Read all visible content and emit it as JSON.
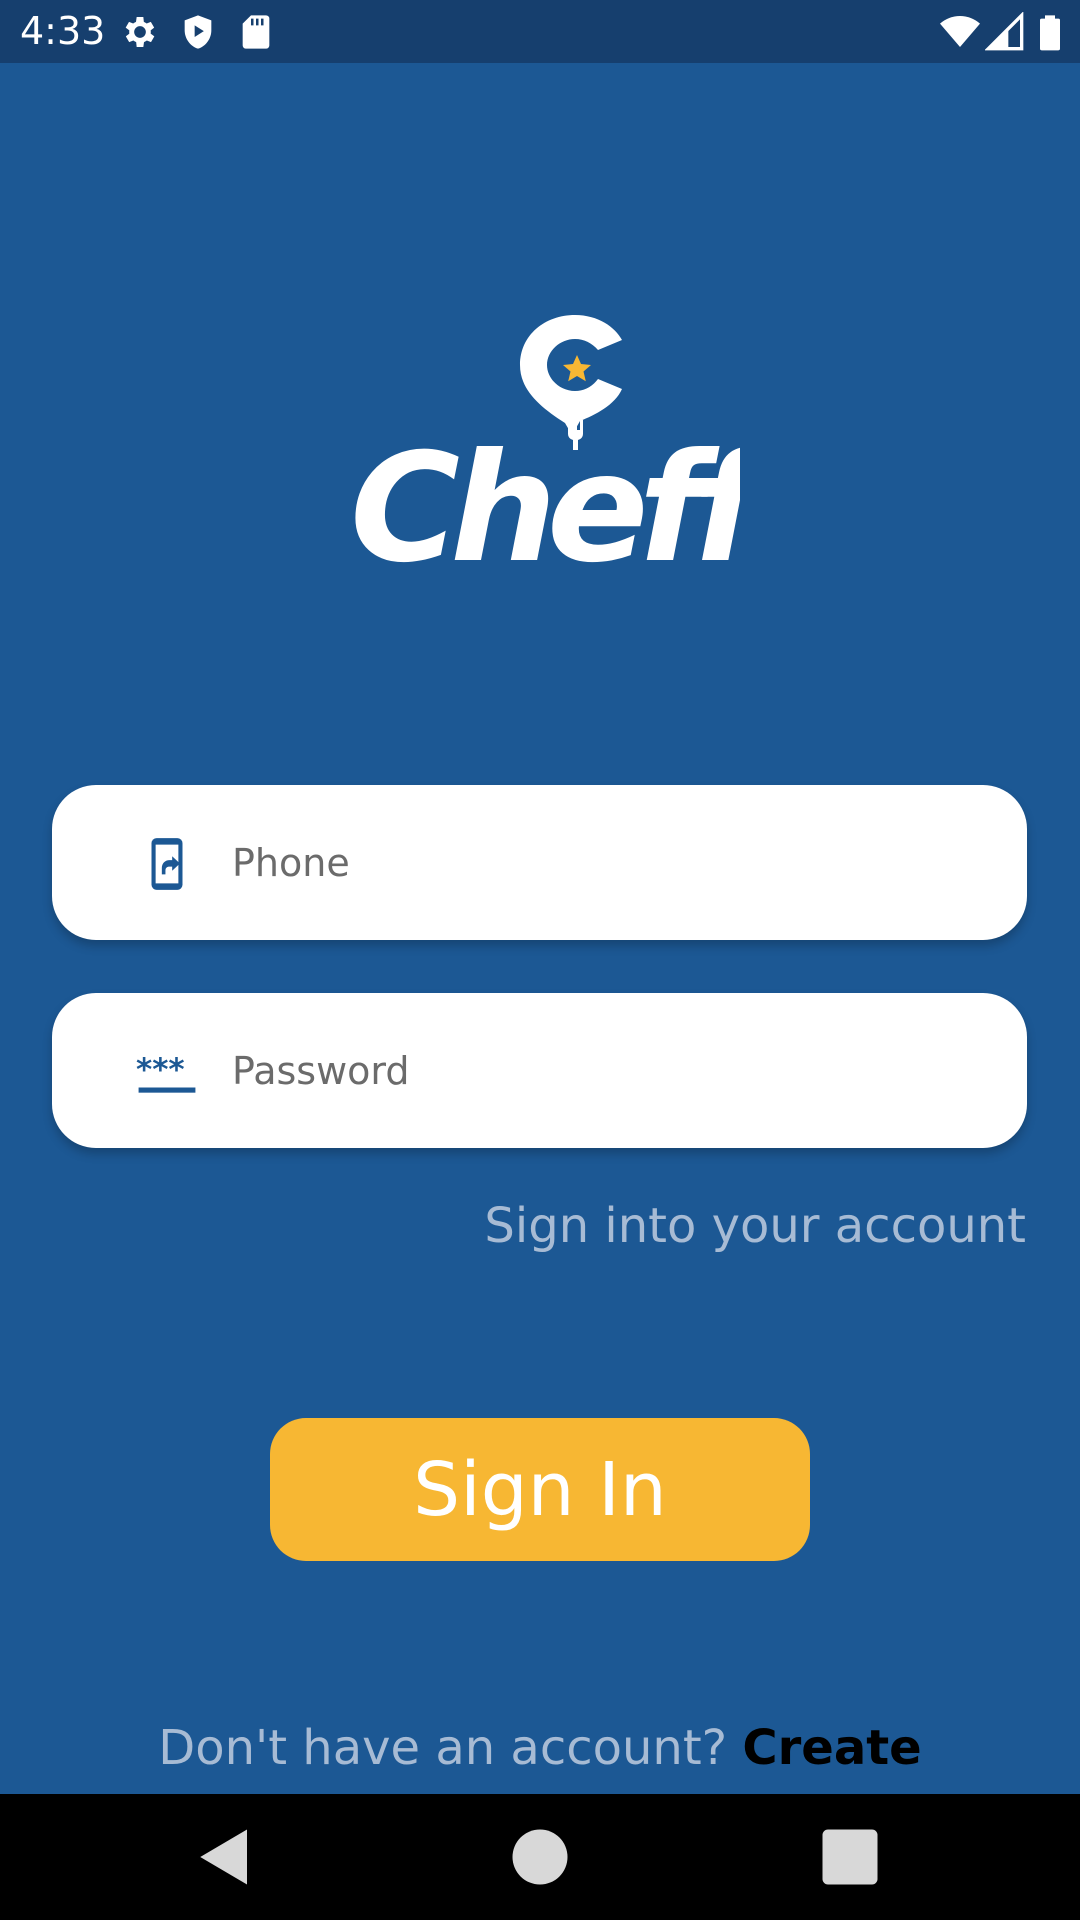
{
  "status_bar": {
    "time": "4:33",
    "icons": [
      "gear-icon",
      "shield-play-icon",
      "sd-card-icon",
      "wifi-icon",
      "signal-icon",
      "battery-icon"
    ]
  },
  "logo": {
    "text": "Cheff"
  },
  "form": {
    "phone": {
      "placeholder": "Phone",
      "value": "",
      "icon": "phone-share-icon"
    },
    "password": {
      "placeholder": "Password",
      "value": "",
      "icon": "password-icon"
    },
    "subtitle": "Sign into your account",
    "submit_label": "Sign In"
  },
  "footer": {
    "prompt": "Don't have an account? ",
    "create_label": "Create"
  },
  "nav_bar": {
    "icons": [
      "back-icon",
      "home-icon",
      "recents-icon"
    ]
  },
  "colors": {
    "background": "#1c5894",
    "status_bar": "#163f6e",
    "accent": "#f7b733",
    "field_icon": "#1c5894",
    "muted_text": "#a7bbd4"
  }
}
